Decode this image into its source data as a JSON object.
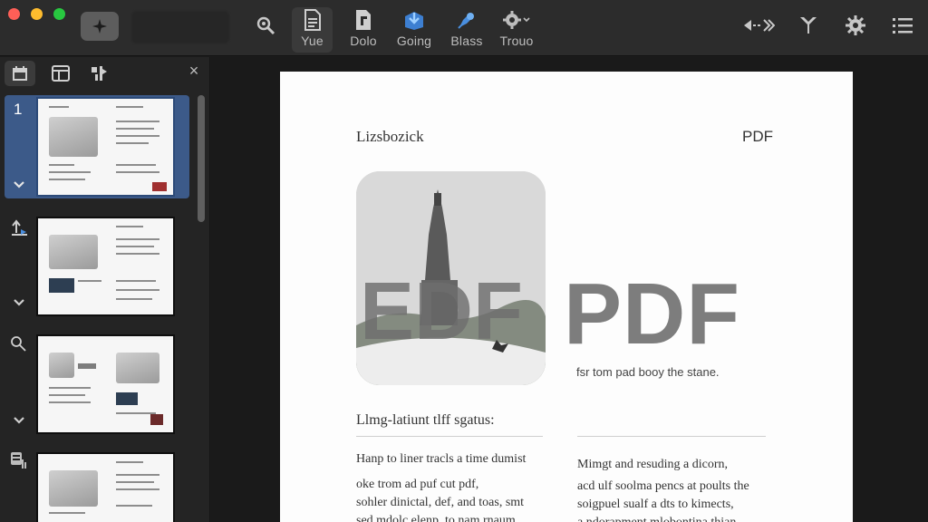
{
  "toolbar": {
    "tools": [
      {
        "label": "Yue",
        "icon": "document-icon"
      },
      {
        "label": "Dolo",
        "icon": "file-icon"
      },
      {
        "label": "Going",
        "icon": "export-icon"
      },
      {
        "label": "Blass",
        "icon": "pen-icon"
      },
      {
        "label": "Trouo",
        "icon": "gear-dropdown-icon"
      }
    ],
    "right_icons": [
      "split-view-icon",
      "filter-icon",
      "settings-icon",
      "list-icon"
    ]
  },
  "sidebar": {
    "close_label": "×",
    "selected_page": "1"
  },
  "document": {
    "header_left": "Lizsbozick",
    "header_right": "PDF",
    "hero_overlay_text": "EDF",
    "big_title": "PDF",
    "tagline": "fsr tom pad booy the stane.",
    "section_heading": "Llmg-latiunt tlff sgatus:",
    "left_column": [
      "Hanp to liner tracls a time dumist",
      "oke trom ad puf cut pdf,",
      "sohler dinictal, def, and toas, smt",
      "sed mdolc elenp. to nam rnaum"
    ],
    "right_column": [
      "Mimgt and resuding a dicorn,",
      "acd ulf soolma pencs at poults the",
      "soigpuel sualf a dts to kimects,",
      "a ndorapment mlobontina thian"
    ]
  },
  "colors": {
    "toolbar_bg": "#2c2c2c",
    "sidebar_bg": "#242424",
    "selection": "#3c5a89",
    "accent_blue": "#4a8fe0"
  }
}
